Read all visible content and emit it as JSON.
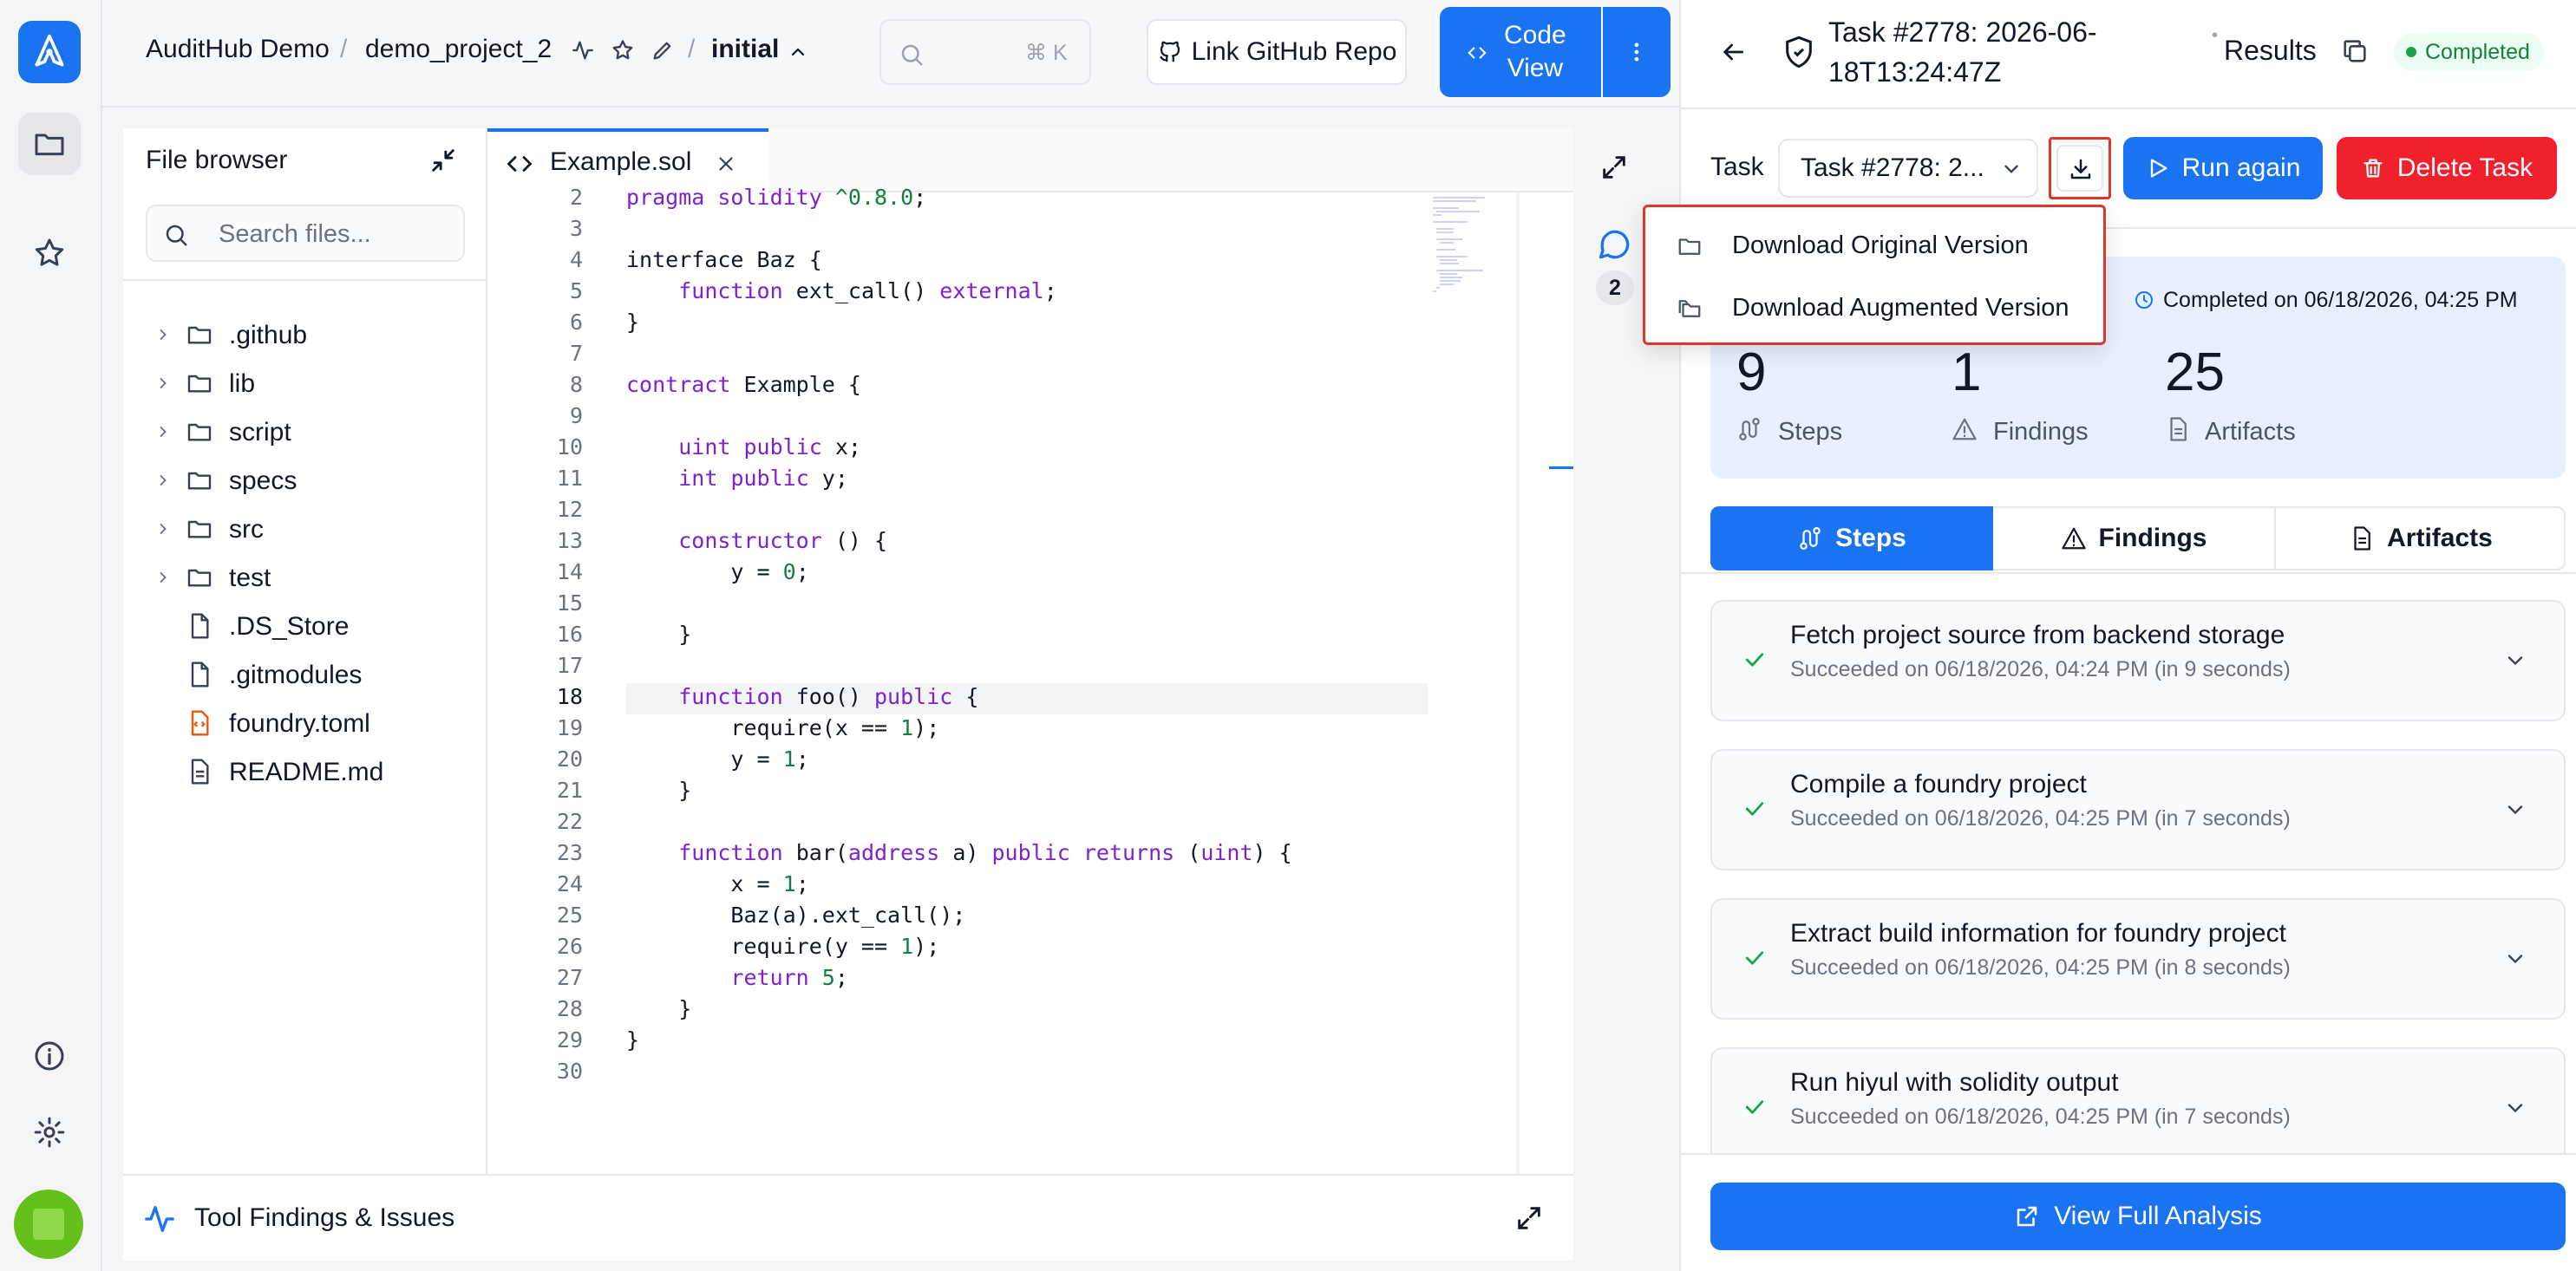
{
  "header": {
    "org": "AuditHub Demo",
    "sep1": "/",
    "project": "demo_project_2",
    "sep2": "/",
    "branch": "initial",
    "search_shortcut": "⌘ K",
    "link_github_label": "Link GitHub Repo",
    "code_view_label_line1": "Code",
    "code_view_label_line2": "View"
  },
  "file_browser": {
    "title": "File browser",
    "search_placeholder": "Search files...",
    "items": [
      {
        "name": ".github",
        "type": "folder"
      },
      {
        "name": "lib",
        "type": "folder"
      },
      {
        "name": "script",
        "type": "folder"
      },
      {
        "name": "specs",
        "type": "folder"
      },
      {
        "name": "src",
        "type": "folder"
      },
      {
        "name": "test",
        "type": "folder"
      },
      {
        "name": ".DS_Store",
        "type": "file"
      },
      {
        "name": ".gitmodules",
        "type": "file"
      },
      {
        "name": "foundry.toml",
        "type": "config"
      },
      {
        "name": "README.md",
        "type": "doc"
      }
    ]
  },
  "editor": {
    "tab_name": "Example.sol",
    "line_numbers": [
      "2",
      "3",
      "4",
      "5",
      "6",
      "7",
      "8",
      "9",
      "10",
      "11",
      "12",
      "13",
      "14",
      "15",
      "16",
      "17",
      "18",
      "19",
      "20",
      "21",
      "22",
      "23",
      "24",
      "25",
      "26",
      "27",
      "28",
      "29",
      "30"
    ],
    "active_line": "18",
    "comment_count": "2"
  },
  "bottom": {
    "label": "Tool Findings & Issues"
  },
  "task_panel": {
    "title_line1": "Task #2778: 2026-06-",
    "title_line2": "18T13:24:47Z",
    "results_label": "Results",
    "status": "Completed",
    "task_label": "Task",
    "task_select_value": "Task #2778: 2...",
    "run_again_label": "Run again",
    "delete_label": "Delete Task",
    "completed_on": "Completed on 06/18/2026, 04:25 PM",
    "stats": [
      {
        "value": "9",
        "label": "Steps"
      },
      {
        "value": "1",
        "label": "Findings"
      },
      {
        "value": "25",
        "label": "Artifacts"
      }
    ],
    "tabs": [
      "Steps",
      "Findings",
      "Artifacts"
    ],
    "steps": [
      {
        "title": "Fetch project source from backend storage",
        "subtitle": "Succeeded on 06/18/2026, 04:24 PM (in 9 seconds)"
      },
      {
        "title": "Compile a foundry project",
        "subtitle": "Succeeded on 06/18/2026, 04:25 PM (in 7 seconds)"
      },
      {
        "title": "Extract build information for foundry project",
        "subtitle": "Succeeded on 06/18/2026, 04:25 PM (in 8 seconds)"
      },
      {
        "title": "Run hiyul with solidity output",
        "subtitle": "Succeeded on 06/18/2026, 04:25 PM (in 7 seconds)"
      }
    ],
    "view_full_label": "View Full Analysis"
  },
  "download_menu": {
    "items": [
      "Download Original Version",
      "Download Augmented Version"
    ]
  },
  "colors": {
    "primary": "#1a73f0",
    "danger": "#f0202d",
    "success": "#16a34a",
    "highlight_border": "#e0352b"
  }
}
